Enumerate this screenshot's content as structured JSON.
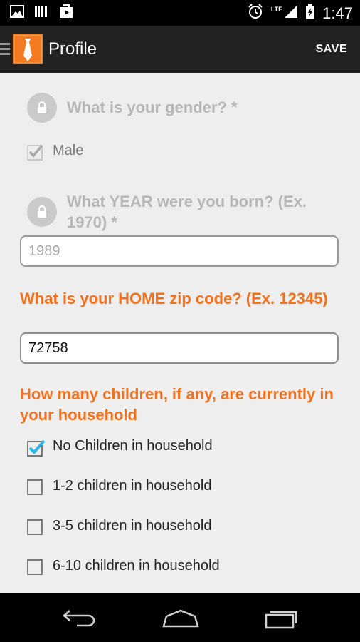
{
  "status_bar": {
    "network": "LTE",
    "time": "1:47"
  },
  "action_bar": {
    "title": "Profile",
    "save_label": "SAVE"
  },
  "form": {
    "gender": {
      "question": "What is your gender? *",
      "option_label": "Male",
      "checked": true,
      "locked": true
    },
    "birth_year": {
      "question": "What YEAR were you born? (Ex. 1970) *",
      "value": "1989",
      "locked": true
    },
    "zip": {
      "question": "What is your HOME zip code? (Ex. 12345)",
      "value": "72758"
    },
    "children": {
      "question": "How many children, if any, are currently in your household",
      "options": [
        {
          "label": "No Children in household",
          "checked": true
        },
        {
          "label": "1-2 children in household",
          "checked": false
        },
        {
          "label": "3-5 children in household",
          "checked": false
        },
        {
          "label": "6-10 children in household",
          "checked": false
        }
      ]
    }
  },
  "colors": {
    "accent": "#f4701a",
    "check_blue": "#33b5e5",
    "disabled_text": "#b7b7b7",
    "background": "#eeeeee"
  },
  "icons": [
    "image-icon",
    "barcode-icon",
    "play-store-icon",
    "alarm-icon",
    "signal-icon",
    "battery-icon",
    "menu-icon",
    "tie-app-icon",
    "lock-icon",
    "back-icon",
    "home-icon",
    "recent-apps-icon"
  ]
}
